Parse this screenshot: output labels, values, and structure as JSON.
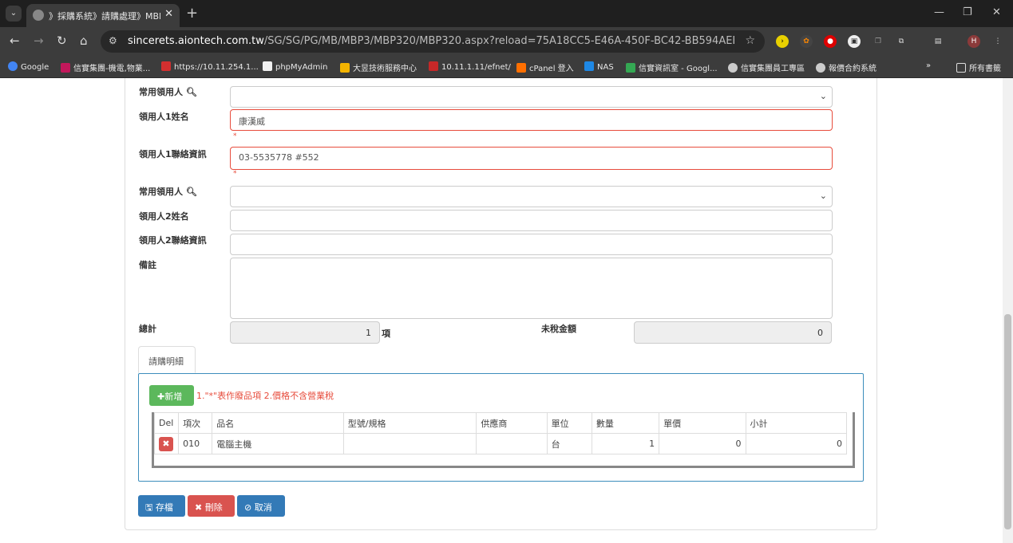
{
  "browser": {
    "tab_title": "》採購系統》請購處理》MBP3",
    "url_domain": "sincerets.aiontech.com.tw",
    "url_path": "/SG/SG/PG/MB/MBP3/MBP320/MBP320.aspx?reload=75A18CC5-E46A-450F-BC42-BB594AEEEF0D&SN=MBP320...",
    "profile_initial": "H",
    "bookmarks": [
      "Google",
      "信實集團-機電,物業...",
      "https://10.11.254.1...",
      "phpMyAdmin",
      "大昱技術服務中心",
      "10.11.1.11/efnet/",
      "cPanel 登入",
      "NAS",
      "信實資訊室 - Googl...",
      "信實集團員工專區",
      "報價合約系統"
    ],
    "all_bookmarks": "所有書籤",
    "colors": {
      "tabbar": "#1f1f1f",
      "toolbar": "#3c3c3c"
    }
  },
  "form": {
    "common_receiver1_label": "常用領用人",
    "receiver1_name_label": "領用人1姓名",
    "receiver1_name_value": "康漢威",
    "receiver1_contact_label": "領用人1聯絡資訊",
    "receiver1_contact_value": "03-5535778 #552",
    "common_receiver2_label": "常用領用人",
    "receiver2_name_label": "領用人2姓名",
    "receiver2_contact_label": "領用人2聯絡資訊",
    "remark_label": "備註",
    "total_label": "總計",
    "total_value": "1",
    "total_unit": "項",
    "untaxed_label": "未稅金額",
    "untaxed_value": "0",
    "required_mark": "*"
  },
  "detail": {
    "tab_label": "請購明細",
    "add_button": "新增",
    "note": "1.\"*\"表作廢品項 2.價格不含營業稅",
    "columns": [
      "Del",
      "項次",
      "品名",
      "型號/規格",
      "供應商",
      "單位",
      "數量",
      "單價",
      "小計"
    ],
    "rows": [
      {
        "item_no": "010",
        "name": "電腦主機",
        "model": "",
        "supplier": "",
        "unit": "台",
        "qty": "1",
        "price": "0",
        "subtotal": "0"
      }
    ]
  },
  "actions": {
    "save": "存檔",
    "delete": "刪除",
    "cancel": "取消"
  },
  "colors": {
    "primary": "#337ab7",
    "danger": "#d9534f",
    "success": "#5cb85c",
    "error_border": "#e74c3c"
  }
}
